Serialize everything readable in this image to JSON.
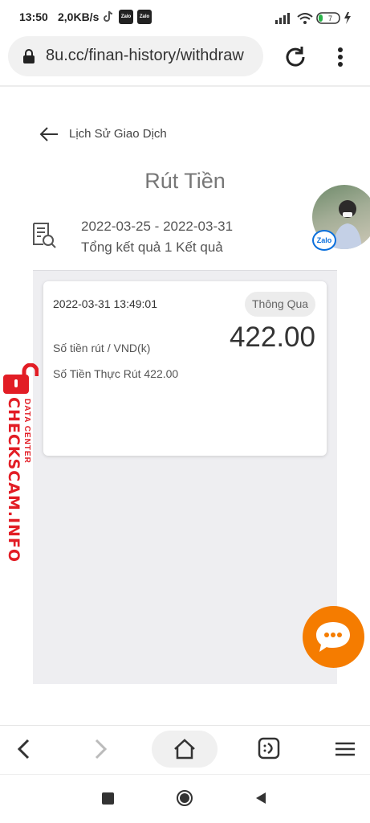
{
  "status_bar": {
    "time": "13:50",
    "network_speed": "2,0KB/s",
    "app_icons": [
      "tiktok-icon",
      "zalo-icon",
      "zalo-icon"
    ],
    "zalo_text": "Zalo",
    "battery_level": "7"
  },
  "browser": {
    "url": "8u.cc/finan-history/withdraw"
  },
  "page": {
    "breadcrumb_title": "Lịch Sử Giao Dịch",
    "title": "Rút Tiền",
    "date_range": "2022-03-25 - 2022-03-31",
    "result_summary": "Tổng kết quả 1 Kết quả"
  },
  "records": [
    {
      "time": "2022-03-31 13:49:01",
      "status": "Thông Qua",
      "amount_label": "Số tiền rút / VND(k)",
      "amount": "422.00",
      "actual_amount": "Số Tiền Thực Rút 422.00"
    }
  ],
  "watermark": {
    "main": "CHECKSCAM.INFO",
    "sub": "DATA CENTER"
  },
  "floating": {
    "zalo_badge": "Zalo"
  },
  "colors": {
    "accent_orange": "#f57c00",
    "watermark_red": "#e21d25",
    "zalo_blue": "#0b6fdc",
    "panel_bg": "#eeeef1"
  }
}
